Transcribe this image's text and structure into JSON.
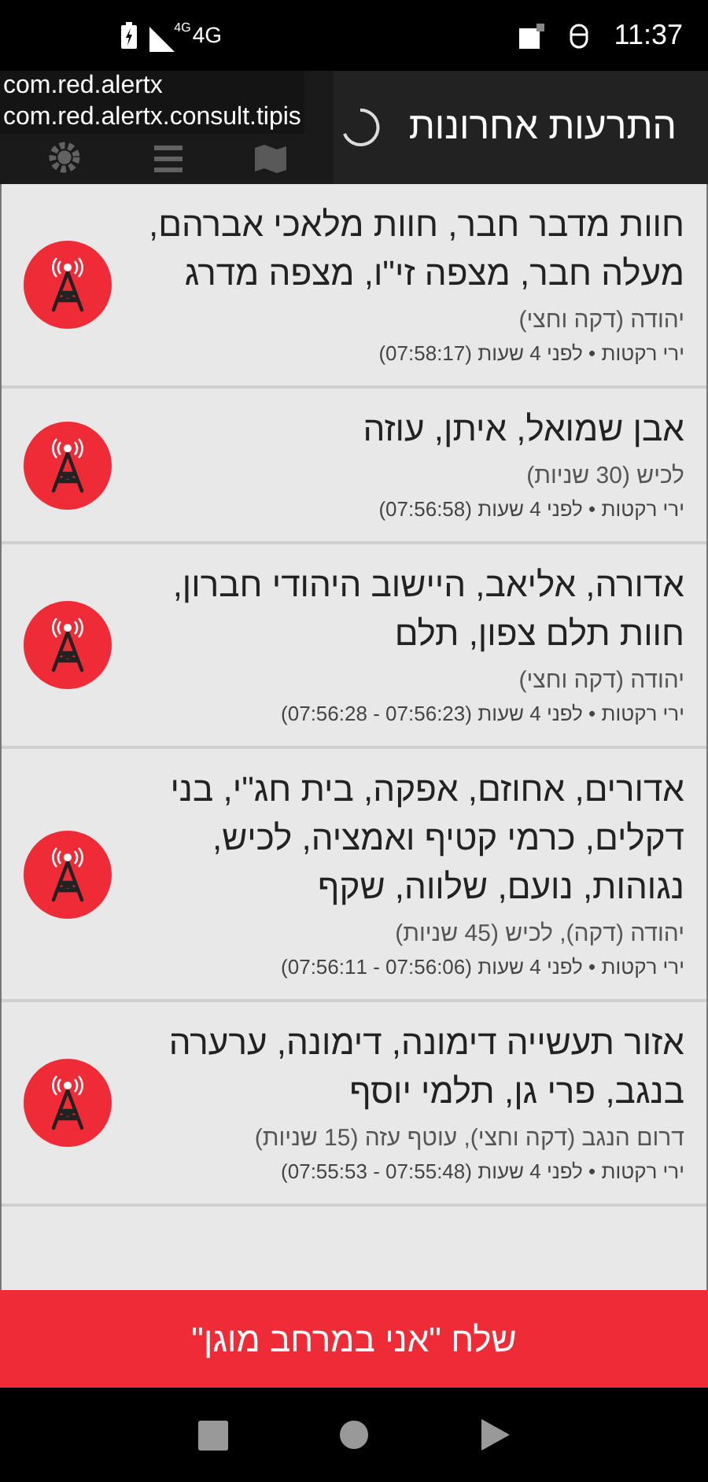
{
  "status_bar": {
    "network_badge": "4G",
    "network": "4G",
    "time": "11:37"
  },
  "toolbar": {
    "title": "התרעות אחרונות",
    "overlay_lines": [
      "com.red.alertx",
      "com.red.alertx.consult.tipis"
    ]
  },
  "alerts": [
    {
      "places": "חוות מדבר חבר, חוות מלאכי אברהם, מעלה חבר, מצפה זי\"ו, מצפה מדרג",
      "area": "יהודה (דקה וחצי)",
      "meta": "ירי רקטות • לפני 4 שעות (07:58:17)"
    },
    {
      "places": "אבן שמואל, איתן, עוזה",
      "area": "לכיש (30 שניות)",
      "meta": "ירי רקטות • לפני 4 שעות (07:56:58)"
    },
    {
      "places": "אדורה, אליאב, היישוב היהודי חברון, חוות תלם צפון, תלם",
      "area": "יהודה (דקה וחצי)",
      "meta": "ירי רקטות • לפני 4 שעות (07:56:23 - 07:56:28)"
    },
    {
      "places": "אדורים, אחוזם, אפקה, בית חג\"י, בני דקלים, כרמי קטיף ואמציה, לכיש, נגוהות, נועם, שלווה, שקף",
      "area": "יהודה (דקה), לכיש (45 שניות)",
      "meta": "ירי רקטות • לפני 4 שעות (07:56:06 - 07:56:11)"
    },
    {
      "places": "אזור תעשייה דימונה, דימונה, ערערה בנגב, פרי גן, תלמי יוסף",
      "area": "דרום הנגב (דקה וחצי), עוטף עזה (15 שניות)",
      "meta": "ירי רקטות • לפני 4 שעות (07:55:48 - 07:55:53)"
    }
  ],
  "action_button": {
    "label": "שלח \"אני במרחב מוגן\""
  }
}
